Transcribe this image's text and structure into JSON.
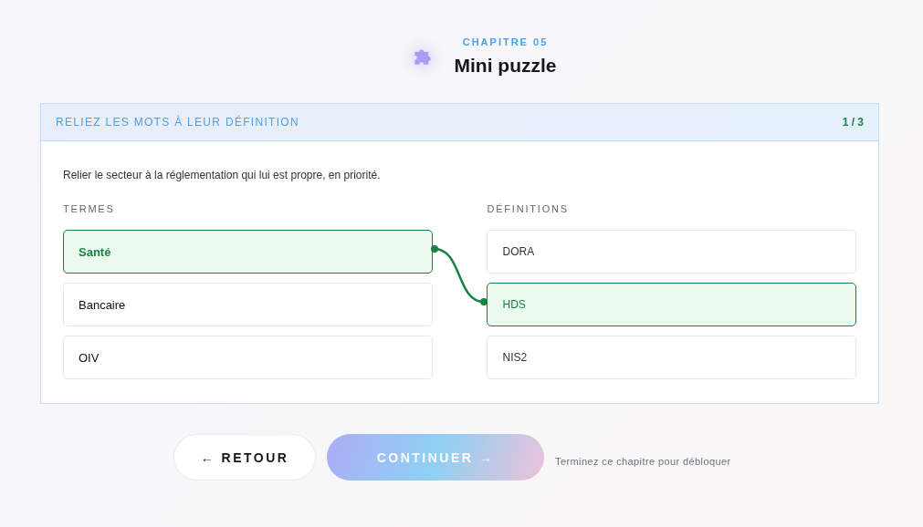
{
  "header": {
    "eyebrow": "CHAPITRE 05",
    "title": "Mini puzzle"
  },
  "card": {
    "heading": "RELIEZ LES MOTS À LEUR DÉFINITION",
    "progress": "1 / 3",
    "instruction": "Relier le secteur à la réglementation qui lui est propre, en priorité.",
    "terms_label": "TERMES",
    "definitions_label": "DÉFINITIONS",
    "terms": [
      {
        "label": "Santé",
        "selected": true
      },
      {
        "label": "Bancaire",
        "selected": false
      },
      {
        "label": "OIV",
        "selected": false
      }
    ],
    "definitions": [
      {
        "label": "DORA",
        "selected": false
      },
      {
        "label": "HDS",
        "selected": true
      },
      {
        "label": "NIS2",
        "selected": false
      }
    ]
  },
  "footer": {
    "back": "← RETOUR",
    "continue": {
      "label": "CONTINUER →",
      "disabled": true
    },
    "hint": "Terminez ce chapitre pour débloquer"
  }
}
